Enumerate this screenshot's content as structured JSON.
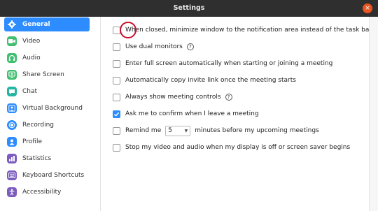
{
  "window": {
    "title": "Settings",
    "close_glyph": "×"
  },
  "sidebar": {
    "items": [
      {
        "label": "General",
        "icon": "gear-icon",
        "color": "#2d8cff",
        "active": true
      },
      {
        "label": "Video",
        "icon": "video-icon",
        "color": "#3fbf6f",
        "active": false
      },
      {
        "label": "Audio",
        "icon": "headphones-icon",
        "color": "#3fbf6f",
        "active": false
      },
      {
        "label": "Share Screen",
        "icon": "share-screen-icon",
        "color": "#3fbf6f",
        "active": false
      },
      {
        "label": "Chat",
        "icon": "chat-icon",
        "color": "#27b5a3",
        "active": false
      },
      {
        "label": "Virtual Background",
        "icon": "person-background-icon",
        "color": "#2d8cff",
        "active": false
      },
      {
        "label": "Recording",
        "icon": "record-icon",
        "color": "#2d8cff",
        "active": false
      },
      {
        "label": "Profile",
        "icon": "profile-icon",
        "color": "#2d8cff",
        "active": false
      },
      {
        "label": "Statistics",
        "icon": "statistics-icon",
        "color": "#7c5cbf",
        "active": false
      },
      {
        "label": "Keyboard Shortcuts",
        "icon": "keyboard-icon",
        "color": "#7c5cbf",
        "active": false
      },
      {
        "label": "Accessibility",
        "icon": "accessibility-icon",
        "color": "#7c5cbf",
        "active": false
      }
    ]
  },
  "general": {
    "options": [
      {
        "label": "When closed, minimize window to the notification area instead of the task bar",
        "checked": false,
        "highlighted": true
      },
      {
        "label": "Use dual monitors",
        "checked": false,
        "help": "?"
      },
      {
        "label": "Enter full screen automatically when starting or joining a meeting",
        "checked": false
      },
      {
        "label": "Automatically copy invite link once the meeting starts",
        "checked": false
      },
      {
        "label": "Always show meeting controls",
        "checked": false,
        "help": "?"
      },
      {
        "label": "Ask me to confirm when I leave a meeting",
        "checked": true
      },
      {
        "label_before": "Remind me",
        "select_value": "5",
        "label_after": "minutes before my upcoming meetings",
        "checked": false
      },
      {
        "label": "Stop my video and audio when my display is off or screen saver begins",
        "checked": false
      }
    ]
  },
  "colors": {
    "accent": "#2d8cff",
    "titlebar": "#2f2f2f",
    "close": "#e95420",
    "highlight_ring": "#c8102e"
  }
}
